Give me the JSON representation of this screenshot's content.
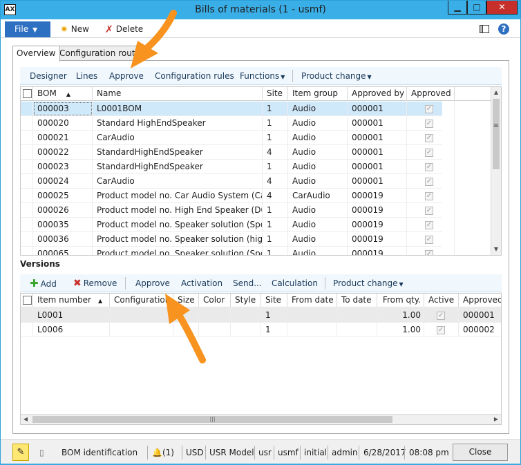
{
  "window": {
    "title": "Bills of materials (1 - usmf)",
    "app_icon": "AX",
    "min": "▁",
    "max": "□",
    "close": "✕"
  },
  "ribbon": {
    "file_label": "File",
    "new_label": "New",
    "delete_label": "Delete",
    "help_label": "?"
  },
  "tabs": [
    {
      "label": "Overview"
    },
    {
      "label": "Configuration route"
    }
  ],
  "bom_toolbar": {
    "designer": "Designer",
    "lines": "Lines",
    "approve": "Approve",
    "configuration_rules": "Configuration rules",
    "functions": "Functions",
    "product_change": "Product change"
  },
  "bom_grid": {
    "columns": [
      "BOM",
      "Name",
      "Site",
      "Item group",
      "Approved by",
      "Approved"
    ],
    "rows": [
      {
        "bom": "000003",
        "name": "L0001BOM",
        "site": "1",
        "item_group": "Audio",
        "approved_by": "000001",
        "approved": true
      },
      {
        "bom": "000020",
        "name": "Standard HighEndSpeaker",
        "site": "1",
        "item_group": "Audio",
        "approved_by": "000001",
        "approved": true
      },
      {
        "bom": "000021",
        "name": "CarAudio",
        "site": "1",
        "item_group": "Audio",
        "approved_by": "000001",
        "approved": true
      },
      {
        "bom": "000022",
        "name": "StandardHighEndSpeaker",
        "site": "4",
        "item_group": "Audio",
        "approved_by": "000001",
        "approved": true
      },
      {
        "bom": "000023",
        "name": "StandardHighEndSpeaker",
        "site": "1",
        "item_group": "Audio",
        "approved_by": "000001",
        "approved": true
      },
      {
        "bom": "000024",
        "name": "CarAudio",
        "site": "4",
        "item_group": "Audio",
        "approved_by": "000001",
        "approved": true
      },
      {
        "bom": "000025",
        "name": "Product model no. Car Audio System (Car ...",
        "site": "4",
        "item_group": "CarAudio",
        "approved_by": "000019",
        "approved": true
      },
      {
        "bom": "000026",
        "name": "Product model no. High End Speaker (D00...",
        "site": "1",
        "item_group": "Audio",
        "approved_by": "000019",
        "approved": true
      },
      {
        "bom": "000035",
        "name": "Product model no. Speaker solution (Spea...",
        "site": "1",
        "item_group": "Audio",
        "approved_by": "000019",
        "approved": true
      },
      {
        "bom": "000036",
        "name": "Product model no. Speaker solution (high...",
        "site": "1",
        "item_group": "Audio",
        "approved_by": "000019",
        "approved": true
      },
      {
        "bom": "000065",
        "name": "Product model no. Speaker solution (Spea...",
        "site": "1",
        "item_group": "Audio",
        "approved_by": "000019",
        "approved": true
      }
    ]
  },
  "versions": {
    "label": "Versions",
    "toolbar": {
      "add": "Add",
      "remove": "Remove",
      "approve": "Approve",
      "activation": "Activation",
      "send": "Send...",
      "calculation": "Calculation",
      "product_change": "Product change"
    },
    "columns": [
      "Item number",
      "Configuration",
      "Size",
      "Color",
      "Style",
      "Site",
      "From date",
      "To date",
      "From qty.",
      "Active",
      "Approved"
    ],
    "rows": [
      {
        "item_number": "L0001",
        "configuration": "",
        "size": "",
        "color": "",
        "style": "",
        "site": "1",
        "from_date": "",
        "to_date": "",
        "from_qty": "1.00",
        "active": true,
        "approved": "000001"
      },
      {
        "item_number": "L0006",
        "configuration": "",
        "size": "",
        "color": "",
        "style": "",
        "site": "1",
        "from_date": "",
        "to_date": "",
        "from_qty": "1.00",
        "active": true,
        "approved": "000002"
      }
    ]
  },
  "statusbar": {
    "identification": "BOM identification",
    "notifications": "(1)",
    "currency": "USD",
    "model": "USR Model",
    "layer": "usr",
    "company": "usmf",
    "partition": "initial",
    "user": "admin",
    "date": "6/28/2017",
    "time": "08:08 pm",
    "close_label": "Close"
  },
  "colors": {
    "title_bar": "#3aaee6",
    "file_button": "#2d6fc1",
    "close_window": "#c7302a",
    "selected_row": "#cfe8fa",
    "annotation_arrow": "#f7931e"
  }
}
